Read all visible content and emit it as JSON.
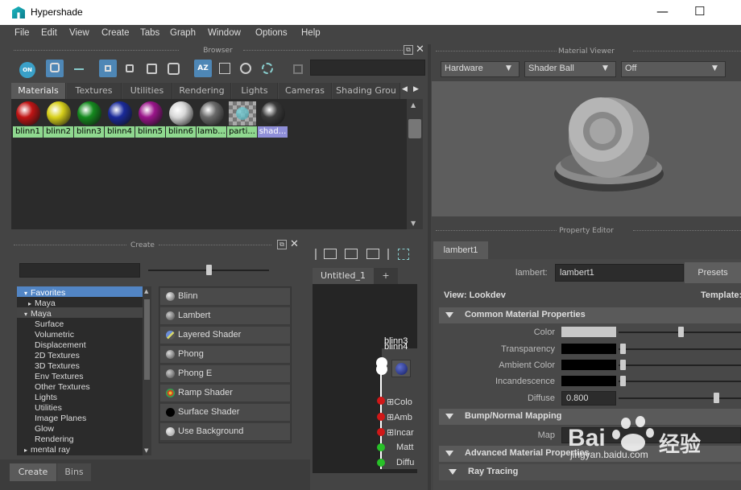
{
  "window": {
    "title": "Hypershade",
    "minimize": "—",
    "maximize": "☐"
  },
  "menu": [
    "File",
    "Edit",
    "View",
    "Create",
    "Tabs",
    "Graph",
    "Window",
    "Options",
    "Help"
  ],
  "browser": {
    "header": "Browser",
    "tabs": [
      "Materials",
      "Textures",
      "Utilities",
      "Rendering",
      "Lights",
      "Cameras",
      "Shading Grou"
    ],
    "swatches": [
      {
        "label": "blinn1",
        "color": "#c01414"
      },
      {
        "label": "blinn2",
        "color": "#d8d01a"
      },
      {
        "label": "blinn3",
        "color": "#148a1e"
      },
      {
        "label": "blinn4",
        "color": "#1a2a9a"
      },
      {
        "label": "blinn5",
        "color": "#9a148a"
      },
      {
        "label": "blinn6",
        "color": "#d8d8d8"
      },
      {
        "label": "lamb...",
        "color": "#6a6a6a"
      },
      {
        "label": "parti...",
        "color": "#4aa0a8"
      },
      {
        "label": "shad...",
        "color": "#3a3a3a"
      }
    ]
  },
  "create": {
    "header": "Create",
    "tree": [
      {
        "label": "Favorites",
        "marker": "▾"
      },
      {
        "label": "Maya",
        "marker": "▸"
      },
      {
        "label": "Maya",
        "marker": "▾"
      },
      {
        "label": "Surface"
      },
      {
        "label": "Volumetric"
      },
      {
        "label": "Displacement"
      },
      {
        "label": "2D Textures"
      },
      {
        "label": "3D Textures"
      },
      {
        "label": "Env Textures"
      },
      {
        "label": "Other Textures"
      },
      {
        "label": "Lights"
      },
      {
        "label": "Utilities"
      },
      {
        "label": "Image Planes"
      },
      {
        "label": "Glow"
      },
      {
        "label": "Rendering"
      },
      {
        "label": "mental ray",
        "marker": "▸"
      }
    ],
    "nodes": [
      {
        "label": "Blinn"
      },
      {
        "label": "Lambert"
      },
      {
        "label": "Layered Shader"
      },
      {
        "label": "Phong"
      },
      {
        "label": "Phong E"
      },
      {
        "label": "Ramp Shader"
      },
      {
        "label": "Surface Shader"
      },
      {
        "label": "Use Background"
      }
    ],
    "bottom_tabs": [
      "Create",
      "Bins"
    ]
  },
  "graph": {
    "tab": "Untitled_1",
    "add_tab": "+",
    "node_titles": [
      "blinn3",
      "blinn4"
    ],
    "attrs": [
      "Colo",
      "Amb",
      "Incar",
      "Matt",
      "Diffu"
    ]
  },
  "material_viewer": {
    "header": "Material Viewer",
    "renderer": "Hardware",
    "geometry": "Shader Ball",
    "env": "Off"
  },
  "property_editor": {
    "header": "Property Editor",
    "tab": "lambert1",
    "name_label": "lambert:",
    "name_value": "lambert1",
    "presets": "Presets",
    "view_label": "View: Lookdev",
    "template_label": "Template:",
    "sections": {
      "common": "Common Material Properties",
      "bump": "Bump/Normal Mapping",
      "advanced": "Advanced Material Properties",
      "raytracing": "Ray Tracing"
    },
    "props": {
      "color": "Color",
      "transparency": "Transparency",
      "ambient": "Ambient Color",
      "incandescence": "Incandescence",
      "diffuse": "Diffuse",
      "diffuse_value": "0.800",
      "map": "Map"
    }
  },
  "watermark": {
    "brand": "Bai",
    "brand2": "经验",
    "url": "jingyan.baidu.com"
  }
}
